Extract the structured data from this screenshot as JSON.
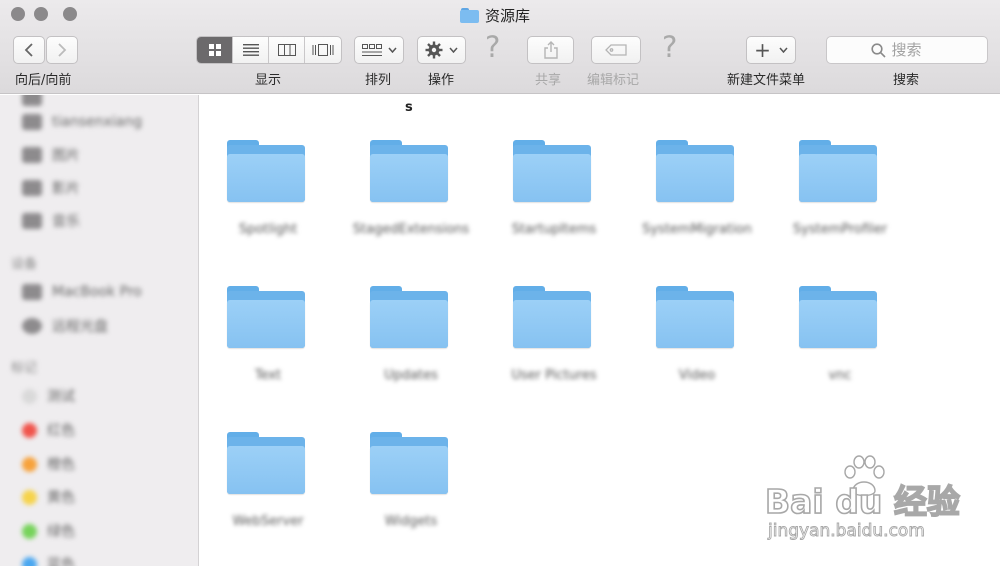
{
  "window": {
    "title": "资源库",
    "traffic_lights": [
      "close",
      "minimize",
      "zoom"
    ]
  },
  "toolbar": {
    "back_forward_label": "向后/向前",
    "view_label": "显示",
    "arrange_label": "排列",
    "action_label": "操作",
    "share_label": "共享",
    "edit_tags_label": "编辑标记",
    "new_folder_menu_label": "新建文件菜单",
    "search_label": "搜索",
    "search_placeholder": "搜索",
    "help_glyph": "?",
    "add_glyph": "+",
    "view_modes": [
      "icon-view",
      "list-view",
      "column-view",
      "cover-flow-view"
    ],
    "active_view_mode": "icon-view"
  },
  "sidebar": {
    "items_top": [
      "tiansenxiang",
      "图片",
      "影片",
      "音乐"
    ],
    "devices_heading": "设备",
    "devices": [
      "MacBook Pro",
      "远程光盘"
    ],
    "tags_heading": "标记",
    "tags": [
      {
        "label": "测试",
        "color": "#d9d9d9"
      },
      {
        "label": "红色",
        "color": "#f0544c"
      },
      {
        "label": "橙色",
        "color": "#f7a23b"
      },
      {
        "label": "黄色",
        "color": "#f6d34a"
      },
      {
        "label": "绿色",
        "color": "#76d35a"
      },
      {
        "label": "蓝色",
        "color": "#4aa7f0"
      }
    ]
  },
  "main": {
    "breadcrumb_fragment": "s",
    "files": [
      "Spotlight",
      "StagedExtensions",
      "StartupItems",
      "SystemMigration",
      "SystemProfiler",
      "Text",
      "Updates",
      "User Pictures",
      "Video",
      "vnc",
      "WebServer",
      "Widgets"
    ]
  },
  "watermark": {
    "logo": "Bai du 经验",
    "url": "jingyan.baidu.com"
  },
  "colors": {
    "folder_light": "#9cd0f7",
    "folder_dark": "#6cb3ea",
    "toolbar_bg": "#e4e2e4",
    "sidebar_bg": "#efedef"
  }
}
